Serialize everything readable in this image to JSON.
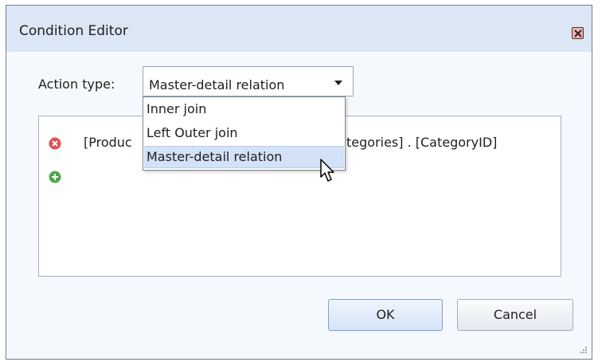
{
  "dialog": {
    "title": "Condition Editor",
    "close_icon": "close-icon"
  },
  "action": {
    "label": "Action type:",
    "selected": "Master-detail relation"
  },
  "dropdown": {
    "options": [
      "Inner join",
      "Left Outer join",
      "Master-detail relation"
    ],
    "highlighted_index": 2
  },
  "condition": {
    "left_visible": "[Produc",
    "right_visible": "tegories] . [CategoryID]",
    "remove_icon": "remove-icon",
    "add_icon": "add-icon"
  },
  "buttons": {
    "ok": "OK",
    "cancel": "Cancel"
  },
  "colors": {
    "titlebar": "#dbe7f5",
    "dialog_bg": "#f5f9fd",
    "selection": "#d3e2f6",
    "remove_red": "#e05050",
    "add_green": "#4aa84a"
  }
}
